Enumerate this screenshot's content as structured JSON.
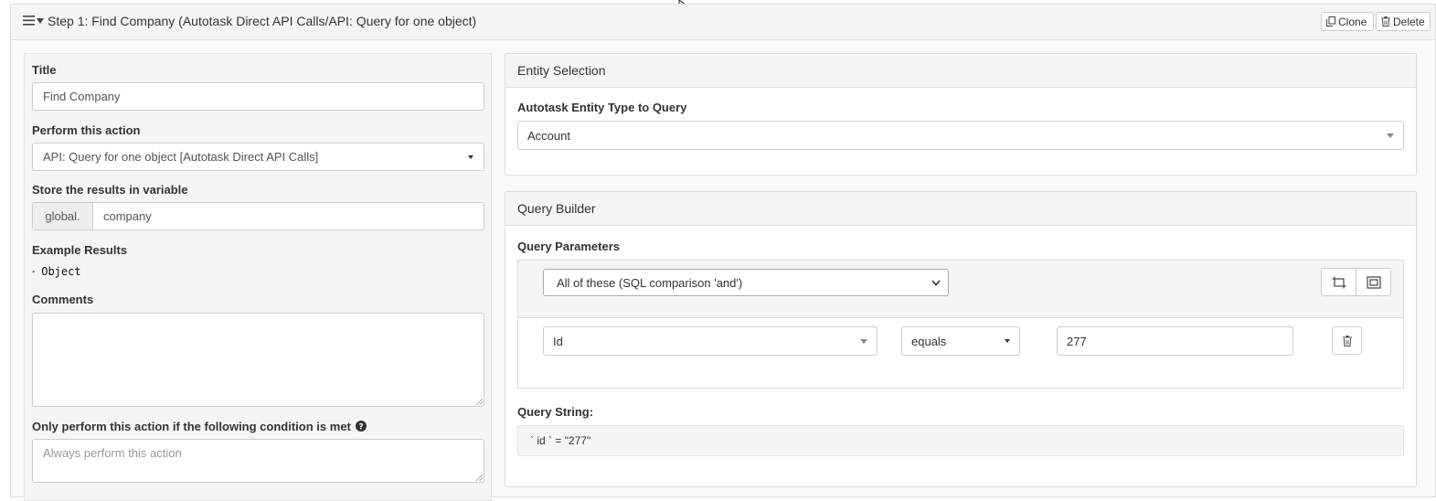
{
  "step": {
    "title": "Step 1: Find Company (Autotask Direct API Calls/API: Query for one object)",
    "clone_label": "Clone",
    "delete_label": "Delete"
  },
  "form": {
    "title_label": "Title",
    "title_value": "Find Company",
    "action_label": "Perform this action",
    "action_value": "API: Query for one object [Autotask Direct API Calls]",
    "store_label": "Store the results in variable",
    "store_prefix": "global.",
    "store_value": "company",
    "example_label": "Example Results",
    "example_value": "Object",
    "comments_label": "Comments",
    "comments_value": "",
    "condition_label": "Only perform this action if the following condition is met",
    "condition_placeholder": "Always perform this action"
  },
  "entity": {
    "heading": "Entity Selection",
    "type_label": "Autotask Entity Type to Query",
    "type_value": "Account"
  },
  "query": {
    "heading": "Query Builder",
    "params_label": "Query Parameters",
    "group_condition": "All of these (SQL comparison 'and')",
    "rule_field": "Id",
    "rule_operator": "equals",
    "rule_value": "277",
    "string_label": "Query String:",
    "string_value": "` id ` = \"277\""
  },
  "icons": {
    "menu": "hamburger-icon",
    "toggle": "caret-down-icon",
    "clone": "copy-icon",
    "delete": "trash-icon",
    "help": "question-circle-icon",
    "add_rule": "add-rule-icon",
    "add_group": "add-group-icon",
    "remove_rule": "trash-icon"
  }
}
